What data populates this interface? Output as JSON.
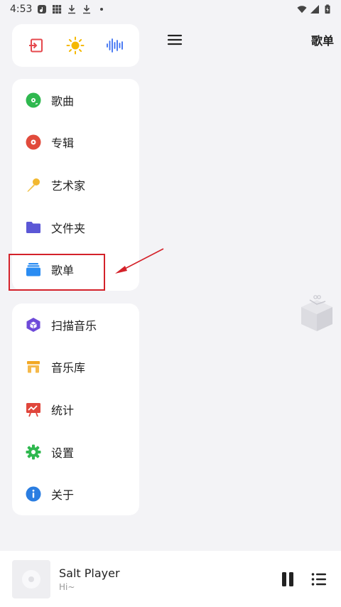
{
  "status_bar": {
    "time": "4:53",
    "icons": [
      "app-notification-icon",
      "grid-icon",
      "download-icon",
      "download-icon",
      "dot-icon"
    ],
    "right_icons": [
      "wifi-icon",
      "signal-icon",
      "battery-icon"
    ]
  },
  "header": {
    "title": "歌单",
    "menu_icon": "hamburger-menu-icon"
  },
  "quick_actions": [
    {
      "name": "exit-icon",
      "color": "#e5484d"
    },
    {
      "name": "sun-icon",
      "color": "#f5b800"
    },
    {
      "name": "audio-wave-icon",
      "color": "#3a6ff2"
    }
  ],
  "library": {
    "items": [
      {
        "label": "歌曲",
        "icon": "song-disc-icon",
        "color": "#2fb84f"
      },
      {
        "label": "专辑",
        "icon": "album-disc-icon",
        "color": "#e14b3c"
      },
      {
        "label": "艺术家",
        "icon": "microphone-icon",
        "color": "#f2b830"
      },
      {
        "label": "文件夹",
        "icon": "folder-icon",
        "color": "#5b57d6"
      },
      {
        "label": "歌单",
        "icon": "playlist-stack-icon",
        "color": "#2a8cf2"
      }
    ]
  },
  "tools": {
    "items": [
      {
        "label": "扫描音乐",
        "icon": "scan-cube-icon",
        "color": "#6e4ad9"
      },
      {
        "label": "音乐库",
        "icon": "store-icon",
        "color": "#f2a824"
      },
      {
        "label": "统计",
        "icon": "chart-board-icon",
        "color": "#e0463c"
      },
      {
        "label": "设置",
        "icon": "gear-icon",
        "color": "#2fb84f"
      },
      {
        "label": "关于",
        "icon": "info-icon",
        "color": "#2a7de1"
      }
    ]
  },
  "player": {
    "title": "Salt Player",
    "subtitle": "Hi~",
    "pause_icon": "pause-icon",
    "queue_icon": "queue-list-icon"
  }
}
